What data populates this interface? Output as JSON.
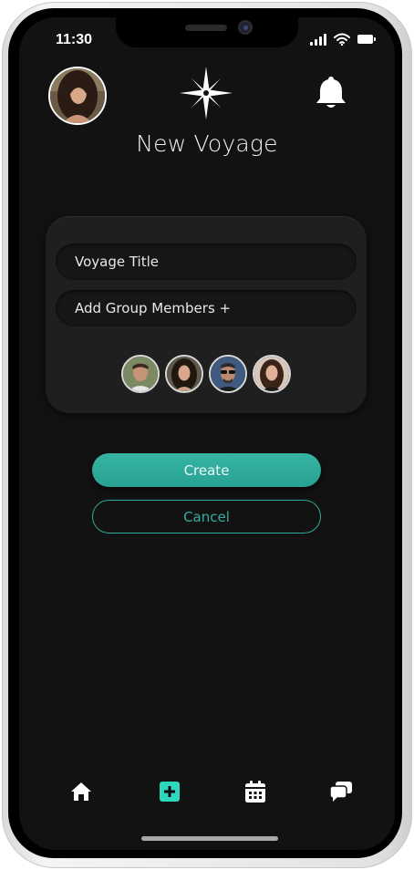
{
  "status_bar": {
    "time": "11:30"
  },
  "header": {
    "profile_avatar": "woman-portrait",
    "logo_icon": "compass-star-icon",
    "notification_icon": "bell-icon"
  },
  "page": {
    "title": "New Voyage"
  },
  "form": {
    "voyage_title_placeholder": "Voyage Title",
    "add_members_label": "Add Group Members +",
    "members": [
      {
        "name": "member-1",
        "avatar": "man-portrait"
      },
      {
        "name": "member-2",
        "avatar": "woman-portrait"
      },
      {
        "name": "member-3",
        "avatar": "man-sunglasses-portrait"
      },
      {
        "name": "member-4",
        "avatar": "woman-portrait"
      }
    ]
  },
  "actions": {
    "create_label": "Create",
    "cancel_label": "Cancel"
  },
  "tab_bar": {
    "items": [
      {
        "name": "home",
        "icon": "home-icon",
        "active": false
      },
      {
        "name": "new",
        "icon": "plus-square-icon",
        "active": true
      },
      {
        "name": "calendar",
        "icon": "calendar-icon",
        "active": false
      },
      {
        "name": "chat",
        "icon": "chat-icon",
        "active": false
      }
    ]
  },
  "colors": {
    "accent": "#2fae9d",
    "background": "#121212",
    "card": "#1f1f1f",
    "field": "#161616"
  }
}
